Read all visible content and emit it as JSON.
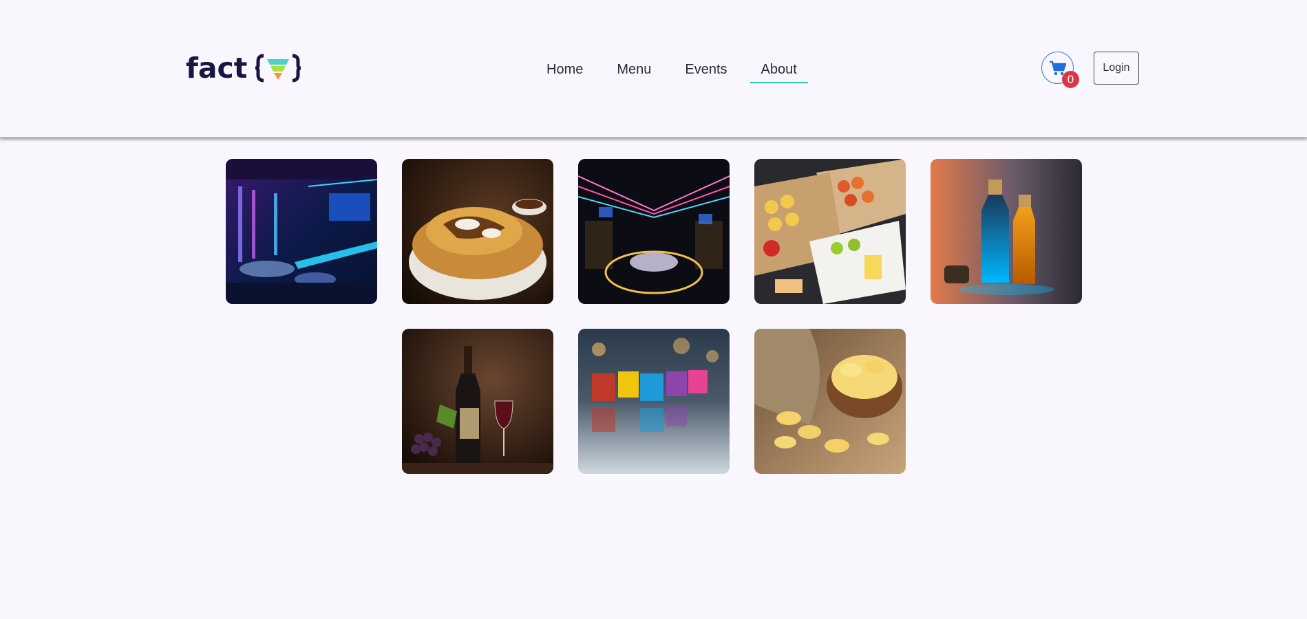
{
  "brand": {
    "word": "fact",
    "mark": "{V}"
  },
  "nav": {
    "items": [
      {
        "label": "Home"
      },
      {
        "label": "Menu"
      },
      {
        "label": "Events"
      },
      {
        "label": "About",
        "active": true
      }
    ]
  },
  "cart": {
    "icon": "cart-icon",
    "count": "0"
  },
  "login": {
    "label": "Login"
  },
  "gallery": {
    "images": [
      {
        "name": "neon-lounge-interior"
      },
      {
        "name": "poutine-fries-bowl"
      },
      {
        "name": "neon-bar-corridor"
      },
      {
        "name": "appetizer-platters"
      },
      {
        "name": "glowing-bottles"
      },
      {
        "name": "wine-bottle-grapes"
      },
      {
        "name": "colorful-shot-glasses"
      },
      {
        "name": "potato-chips-bowl"
      }
    ]
  },
  "colors": {
    "accent": "#30c7c1",
    "brand": "#17173f",
    "cart_border": "#2d79e6",
    "badge": "#dc3545"
  }
}
